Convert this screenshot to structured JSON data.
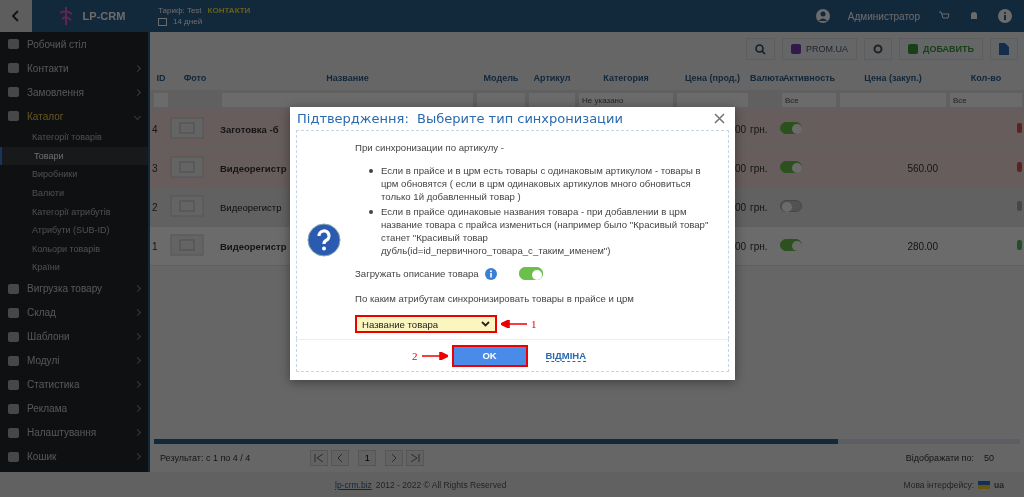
{
  "header": {
    "logo": "LP-CRM",
    "tariff": "Тариф: Test",
    "days": "14 дней",
    "contacts_badge": "КОНТАКТИ",
    "user": "Администратор"
  },
  "toolbar": {
    "buttons": [
      {
        "kind": "search"
      },
      {
        "kind": "prom",
        "label": "PROM.UA"
      },
      {
        "kind": "settings"
      },
      {
        "kind": "add",
        "label": "ДОБАВИТЬ"
      },
      {
        "kind": "file"
      }
    ]
  },
  "sidebar": {
    "items": [
      {
        "label": "Робочий стіл",
        "selected": false
      },
      {
        "label": "Контакти",
        "selected": false,
        "expanded": false
      },
      {
        "label": "Замовлення",
        "selected": false,
        "expanded": false
      },
      {
        "label": "Каталог",
        "selected": true,
        "expanded": true,
        "children": [
          {
            "label": "Категорії товарів",
            "selected": false
          },
          {
            "label": "Товари",
            "selected": true
          },
          {
            "label": "Виробники",
            "selected": false
          },
          {
            "label": "Валюти",
            "selected": false
          },
          {
            "label": "Категорії атрибутів",
            "selected": false
          },
          {
            "label": "Атрибути (SUB-ID)",
            "selected": false
          },
          {
            "label": "Кольори товарів",
            "selected": false
          },
          {
            "label": "Країни",
            "selected": false
          }
        ]
      },
      {
        "label": "Вигрузка товару",
        "selected": false,
        "expanded": false
      },
      {
        "label": "Склад",
        "selected": false,
        "expanded": false
      },
      {
        "label": "Шаблони",
        "selected": false,
        "expanded": false
      },
      {
        "label": "Модулі",
        "selected": false,
        "expanded": false
      },
      {
        "label": "Статистика",
        "selected": false,
        "expanded": false
      },
      {
        "label": "Реклама",
        "selected": false,
        "expanded": false
      },
      {
        "label": "Налаштування",
        "selected": false,
        "expanded": false
      },
      {
        "label": "Кошик",
        "selected": false,
        "expanded": false
      }
    ]
  },
  "table": {
    "columns": [
      "ID",
      "Фото",
      "Название",
      "Модель",
      "Артикул",
      "Категория",
      "Цена (прод.)",
      "Валюта",
      "Активность",
      "Цена (закуп.)",
      "Кол-во"
    ],
    "filters": {
      "category": "Не указано",
      "activity": "Все",
      "quantity": "Все"
    },
    "rows": [
      {
        "id": "4",
        "name": "Заготовка -б",
        "price": "00",
        "currency": "грн.",
        "active": true,
        "purchase": "",
        "color": "#5b2321",
        "kind": "warning"
      },
      {
        "id": "3",
        "name": "Видеорегистр",
        "price": "00",
        "currency": "грн.",
        "active": true,
        "purchase": "560.00",
        "color": "#5b2321",
        "kind": "warning"
      },
      {
        "id": "2",
        "name": "Видеорегистр",
        "price": "00",
        "currency": "грн.",
        "active": false,
        "purchase": "",
        "color": "#474747",
        "kind": "inactive"
      },
      {
        "id": "1",
        "name": "Видеорегистр",
        "price": "00",
        "currency": "грн.",
        "active": true,
        "purchase": "280.00",
        "color": "#274d27",
        "kind": "normal"
      }
    ]
  },
  "footer": {
    "result": "Результат: с 1 по 4 / 4",
    "page": "1",
    "per_page_label": "Відображати по:",
    "per_page": "50",
    "site": "lp-crm.biz",
    "copyright": "2012 - 2022 © All Rights Reserved",
    "language_label": "Мова інтерфейсу:",
    "language": "ua"
  },
  "dialog": {
    "title": "Підтвердження:  Выберите тип синхронизации",
    "intro": "При синхронизации по артикулу -",
    "bullets": [
      "Если в прайсе и в црм есть товары с одинаковым артикулом - товары в црм обновятся ( если в црм одинаковых артикулов много обновиться только 1й добавленный товар )",
      "Если в прайсе одинаковые названия товара - при добавлении в црм название товара с прайса измениться (например было \"Красивый товар\" станет \"Красивый товар дубль(id=id_первичного_товара_с_таким_именем\")"
    ],
    "description_toggle": {
      "label": "Загружать описание товара",
      "on": true
    },
    "attributes_label": "По каким атрибутам синхронизировать товары в прайсе и црм",
    "select": {
      "value": "Название товара"
    },
    "ok": "OK",
    "cancel": "ВІДМІНА",
    "annotations": [
      "1",
      "2"
    ]
  }
}
